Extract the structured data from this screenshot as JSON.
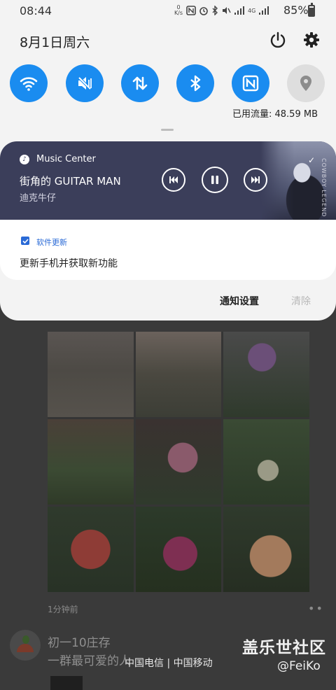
{
  "status_bar": {
    "time": "08:44",
    "net_speed_unit": "K/s",
    "net_speed_value": "0",
    "signal_label": "4G",
    "battery_percent": "85%",
    "battery_level": 0.85
  },
  "quick_panel": {
    "date": "8月1日周六",
    "toggles": [
      {
        "name": "wifi",
        "icon": "wifi-icon",
        "on": true
      },
      {
        "name": "sound",
        "icon": "mute-icon",
        "on": true
      },
      {
        "name": "mobile-data",
        "icon": "data-arrows-icon",
        "on": true
      },
      {
        "name": "bluetooth",
        "icon": "bluetooth-icon",
        "on": true
      },
      {
        "name": "nfc",
        "icon": "nfc-icon",
        "on": true
      },
      {
        "name": "location",
        "icon": "location-icon",
        "on": false
      }
    ],
    "data_usage": "已用流量: 48.59 MB"
  },
  "media": {
    "app": "Music Center",
    "title": "街角的 GUITAR MAN",
    "artist": "迪克牛仔",
    "art_caption": "COWBOY LEGEND"
  },
  "notification": {
    "app": "软件更新",
    "text": "更新手机并获取新功能"
  },
  "footer": {
    "settings": "通知设置",
    "clear": "清除"
  },
  "background_app": {
    "time_ago": "1分钟前",
    "user": "初一10庄存",
    "line2": "一群最可爱的人",
    "carriers": "中国电信 | 中国移动",
    "watermark_title": "盖乐世社区",
    "watermark_handle": "@FeiKo"
  },
  "colors": {
    "accent": "#1a8cf0",
    "media_card": "#3b3e5a",
    "notification_app": "#2a6ad6"
  }
}
